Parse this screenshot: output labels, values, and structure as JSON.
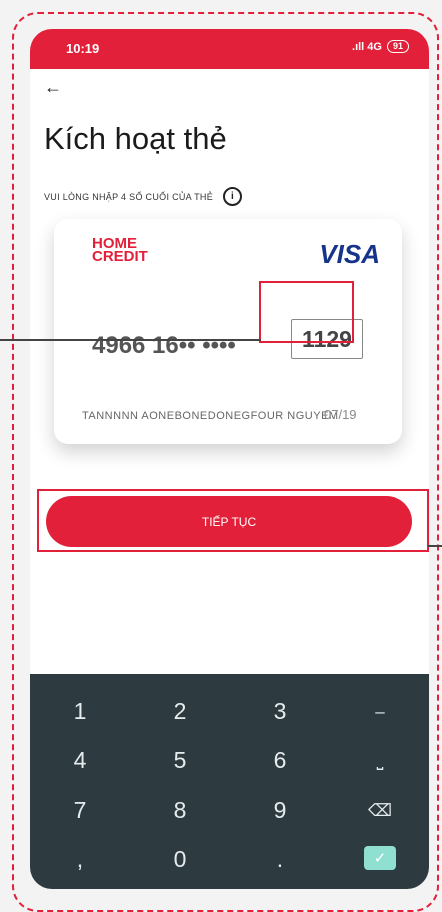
{
  "status_bar": {
    "time": "10:19",
    "signal": ".ıll 4G",
    "battery": "91"
  },
  "back_arrow": "←",
  "title": "Kích hoạt thẻ",
  "subtitle": "VUI LÒNG NHẬP 4 SỐ CUỐI CỦA THẺ",
  "info_icon": "i",
  "card": {
    "issuer_logo": [
      "HOME",
      "CREDIT"
    ],
    "brand": "VISA",
    "number_masked": "4966 16•• ••••",
    "last4": "1129",
    "holder": "TANNNNN AONEBONEDONEGFOUR NGUYEM",
    "expiry": "07/19"
  },
  "continue_button": "TIẾP TỤC",
  "keypad": {
    "rows": [
      [
        "1",
        "2",
        "3",
        "–"
      ],
      [
        "4",
        "5",
        "6",
        "⎵"
      ],
      [
        "7",
        "8",
        "9",
        "⌫"
      ],
      [
        ",",
        "0",
        ".",
        "✓"
      ]
    ]
  },
  "colors": {
    "accent": "#e3203a",
    "keypad_bg": "#2d3b40",
    "enter_key": "#8fe0d0",
    "visa": "#16348a"
  }
}
